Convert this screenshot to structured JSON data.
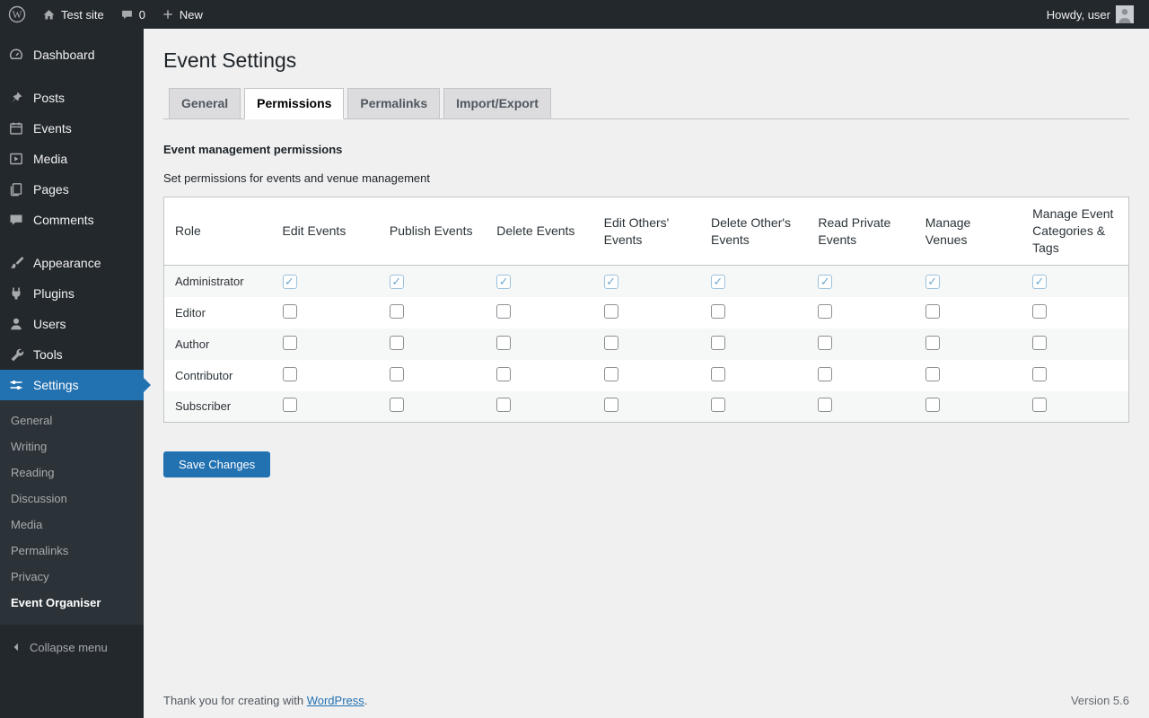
{
  "admin_bar": {
    "site_name": "Test site",
    "comment_count": "0",
    "new_label": "New",
    "greeting": "Howdy, user"
  },
  "sidebar": {
    "menu": [
      {
        "label": "Dashboard",
        "icon": "dashboard-icon"
      },
      {
        "label": "Posts",
        "icon": "posts-icon",
        "section_start": true
      },
      {
        "label": "Events",
        "icon": "events-icon"
      },
      {
        "label": "Media",
        "icon": "media-icon"
      },
      {
        "label": "Pages",
        "icon": "pages-icon"
      },
      {
        "label": "Comments",
        "icon": "comments-icon"
      },
      {
        "label": "Appearance",
        "icon": "appearance-icon",
        "section_start": true
      },
      {
        "label": "Plugins",
        "icon": "plugins-icon"
      },
      {
        "label": "Users",
        "icon": "users-icon"
      },
      {
        "label": "Tools",
        "icon": "tools-icon"
      },
      {
        "label": "Settings",
        "icon": "settings-icon",
        "active": true
      }
    ],
    "settings_submenu": [
      {
        "label": "General"
      },
      {
        "label": "Writing"
      },
      {
        "label": "Reading"
      },
      {
        "label": "Discussion"
      },
      {
        "label": "Media"
      },
      {
        "label": "Permalinks"
      },
      {
        "label": "Privacy"
      },
      {
        "label": "Event Organiser",
        "active": true
      }
    ],
    "collapse_label": "Collapse menu"
  },
  "page": {
    "title": "Event Settings",
    "tabs": [
      {
        "label": "General"
      },
      {
        "label": "Permissions",
        "active": true
      },
      {
        "label": "Permalinks"
      },
      {
        "label": "Import/Export"
      }
    ],
    "section_heading": "Event management permissions",
    "section_description": "Set permissions for events and venue management",
    "permissions_table": {
      "columns": [
        "Role",
        "Edit Events",
        "Publish Events",
        "Delete Events",
        "Edit Others' Events",
        "Delete Other's Events",
        "Read Private Events",
        "Manage Venues",
        "Manage Event Categories & Tags"
      ],
      "rows": [
        {
          "role": "Administrator",
          "disabled": true,
          "permissions": [
            true,
            true,
            true,
            true,
            true,
            true,
            true,
            true
          ]
        },
        {
          "role": "Editor",
          "permissions": [
            false,
            false,
            false,
            false,
            false,
            false,
            false,
            false
          ]
        },
        {
          "role": "Author",
          "permissions": [
            false,
            false,
            false,
            false,
            false,
            false,
            false,
            false
          ]
        },
        {
          "role": "Contributor",
          "permissions": [
            false,
            false,
            false,
            false,
            false,
            false,
            false,
            false
          ]
        },
        {
          "role": "Subscriber",
          "permissions": [
            false,
            false,
            false,
            false,
            false,
            false,
            false,
            false
          ]
        }
      ]
    },
    "save_button": "Save Changes"
  },
  "footer": {
    "thanks_text": "Thank you for creating with ",
    "link_label": "WordPress",
    "thanks_suffix": ".",
    "version": "Version 5.6"
  },
  "colors": {
    "accent": "#2271b1",
    "admin_bar_bg": "#23282d",
    "menu_bg": "#23282d",
    "content_bg": "#f0f0f1"
  }
}
